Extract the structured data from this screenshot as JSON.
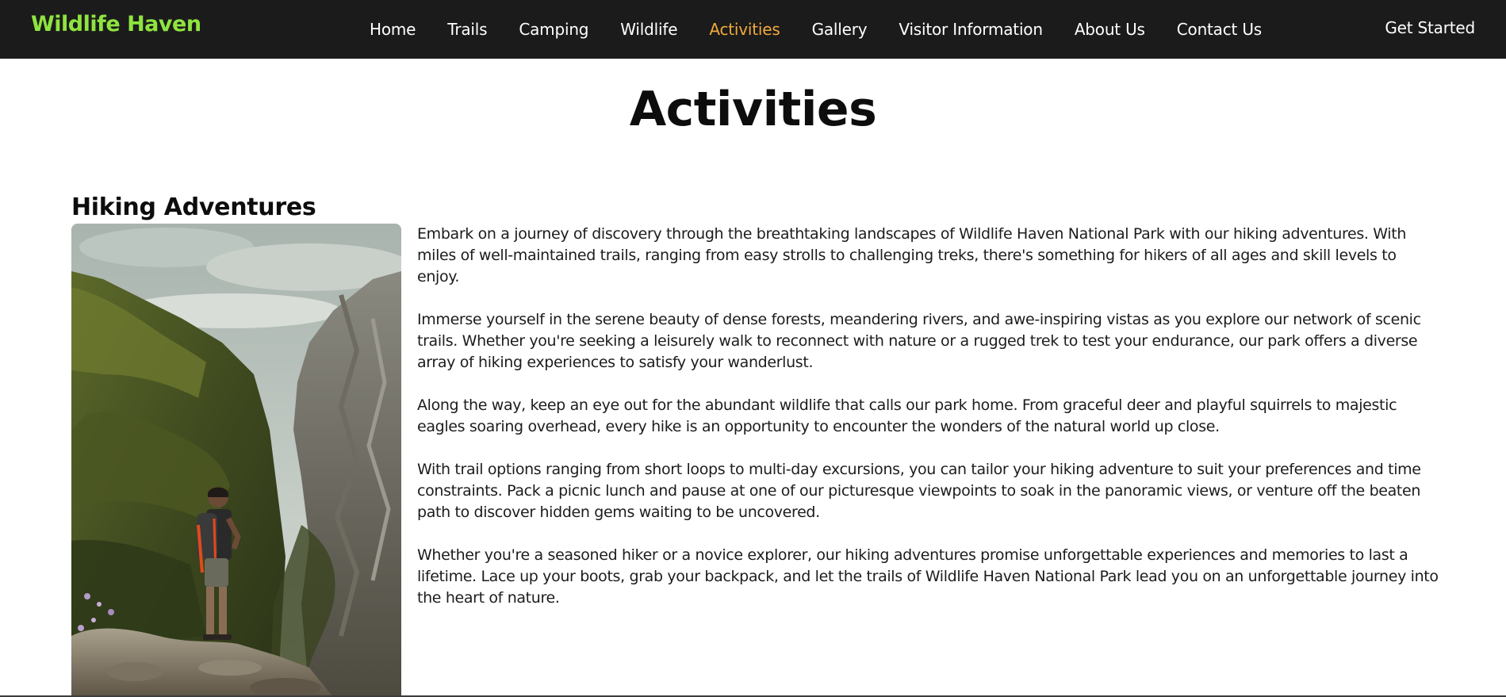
{
  "brand": {
    "logo_text": "Wildlife Haven",
    "logo_color": "#8ee43f"
  },
  "nav": {
    "items": [
      {
        "label": "Home",
        "active": false
      },
      {
        "label": "Trails",
        "active": false
      },
      {
        "label": "Camping",
        "active": false
      },
      {
        "label": "Wildlife",
        "active": false
      },
      {
        "label": "Activities",
        "active": true
      },
      {
        "label": "Gallery",
        "active": false
      },
      {
        "label": "Visitor Information",
        "active": false
      },
      {
        "label": "About Us",
        "active": false
      },
      {
        "label": "Contact Us",
        "active": false
      }
    ],
    "cta_label": "Get Started",
    "background_color": "#1b1b1b",
    "active_color": "#f2a93b"
  },
  "page": {
    "title": "Activities"
  },
  "section": {
    "title": "Hiking Adventures",
    "image_icon": "hiker-on-rocky-cliff-photo",
    "paragraphs": [
      "Embark on a journey of discovery through the breathtaking landscapes of Wildlife Haven National Park with our hiking adventures. With miles of well-maintained trails, ranging from easy strolls to challenging treks, there's something for hikers of all ages and skill levels to enjoy.",
      "Immerse yourself in the serene beauty of dense forests, meandering rivers, and awe-inspiring vistas as you explore our network of scenic trails. Whether you're seeking a leisurely walk to reconnect with nature or a rugged trek to test your endurance, our park offers a diverse array of hiking experiences to satisfy your wanderlust.",
      "Along the way, keep an eye out for the abundant wildlife that calls our park home. From graceful deer and playful squirrels to majestic eagles soaring overhead, every hike is an opportunity to encounter the wonders of the natural world up close.",
      "With trail options ranging from short loops to multi-day excursions, you can tailor your hiking adventure to suit your preferences and time constraints. Pack a picnic lunch and pause at one of our picturesque viewpoints to soak in the panoramic views, or venture off the beaten path to discover hidden gems waiting to be uncovered.",
      "Whether you're a seasoned hiker or a novice explorer, our hiking adventures promise unforgettable experiences and memories to last a lifetime. Lace up your boots, grab your backpack, and let the trails of Wildlife Haven National Park lead you on an unforgettable journey into the heart of nature."
    ]
  }
}
